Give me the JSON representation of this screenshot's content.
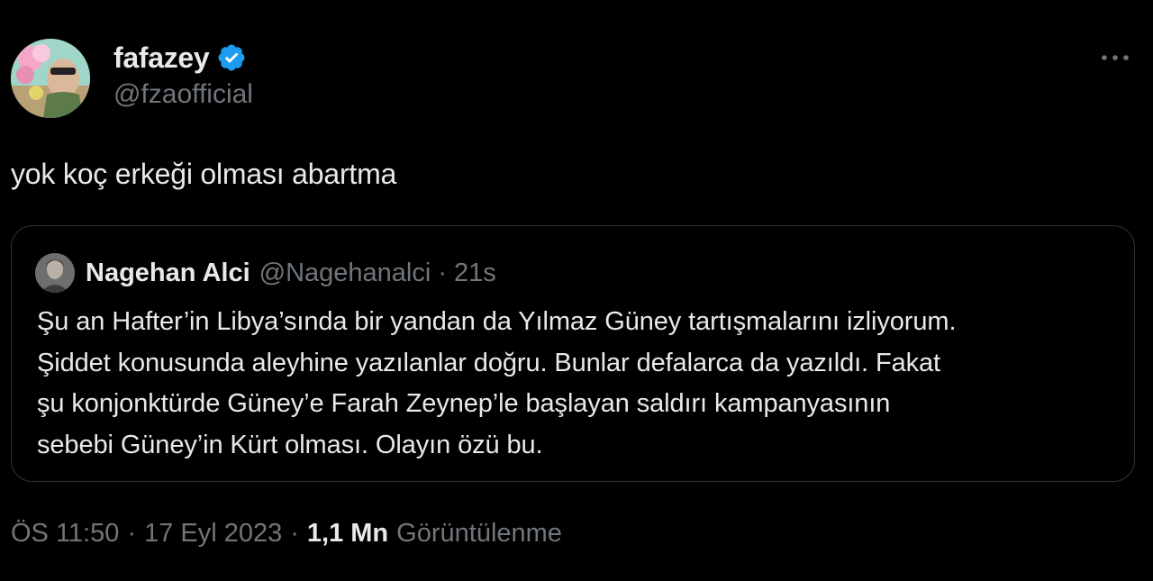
{
  "author": {
    "display_name": "fafazey",
    "handle": "@fzaofficial",
    "verified": true,
    "avatar_icon": "user-avatar-photo",
    "verified_icon": "verified-badge-icon"
  },
  "more_icon": "more-options-icon",
  "tweet": {
    "text": "yok koç erkeği olması abartma"
  },
  "quote": {
    "display_name": "Nagehan Alci",
    "handle": "@Nagehanalci",
    "separator": "·",
    "time": "21s",
    "lines": [
      "Şu an Hafter’in Libya’sında bir yandan da Yılmaz Güney tartışmalarını izliyorum.",
      "Şiddet konusunda aleyhine yazılanlar doğru. Bunlar defalarca da yazıldı. Fakat",
      "şu konjonktürde Güney’e Farah Zeynep’le başlayan saldırı kampanyasının",
      "sebebi Güney’in Kürt olması. Olayın özü bu."
    ]
  },
  "meta": {
    "time": "ÖS 11:50",
    "separator": "·",
    "date": "17 Eyl 2023",
    "views_count": "1,1 Mn",
    "views_label": "Görüntülenme"
  },
  "colors": {
    "background": "#000000",
    "primary_text": "#e7e9ea",
    "secondary_text": "#71767b",
    "border": "#2f3336",
    "verified_blue": "#1d9bf0"
  }
}
